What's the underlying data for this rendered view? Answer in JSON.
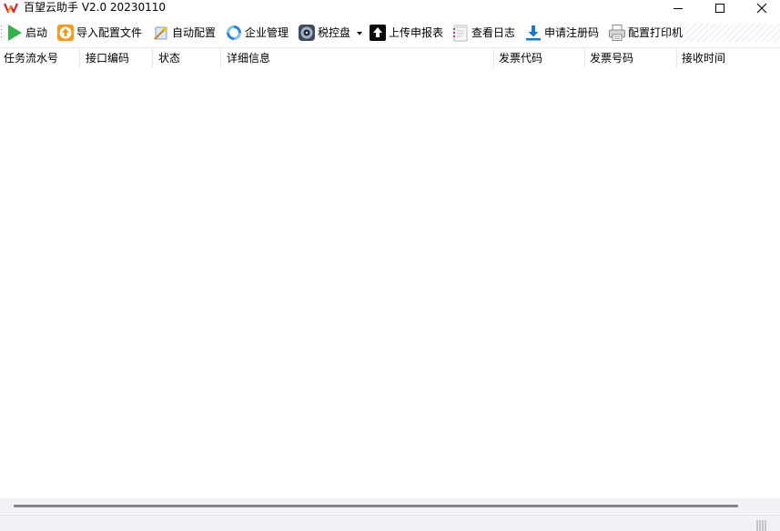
{
  "window": {
    "title": "百望云助手 V2.0  20230110"
  },
  "toolbar": {
    "items": [
      {
        "label": "启动",
        "icon": "play-icon"
      },
      {
        "label": "导入配置文件",
        "icon": "import-upload-icon"
      },
      {
        "label": "自动配置",
        "icon": "auto-config-wand-icon"
      },
      {
        "label": "企业管理",
        "icon": "refresh-manage-icon"
      },
      {
        "label": "税控盘",
        "icon": "tax-disk-icon",
        "has_dropdown": true
      },
      {
        "label": "上传申报表",
        "icon": "upload-arrow-icon"
      },
      {
        "label": "查看日志",
        "icon": "log-notepad-icon"
      },
      {
        "label": "申请注册码",
        "icon": "download-arrow-icon"
      },
      {
        "label": "配置打印机",
        "icon": "printer-icon"
      }
    ]
  },
  "table": {
    "columns": [
      "任务流水号",
      "接口编码",
      "状态",
      "详细信息",
      "发票代码",
      "发票号码",
      "接收时间"
    ],
    "rows": []
  },
  "colors": {
    "accent_green": "#2fb34a",
    "accent_orange": "#f39a1e",
    "accent_blue": "#1e78c8",
    "chrome_bg": "#f0f2f5"
  }
}
